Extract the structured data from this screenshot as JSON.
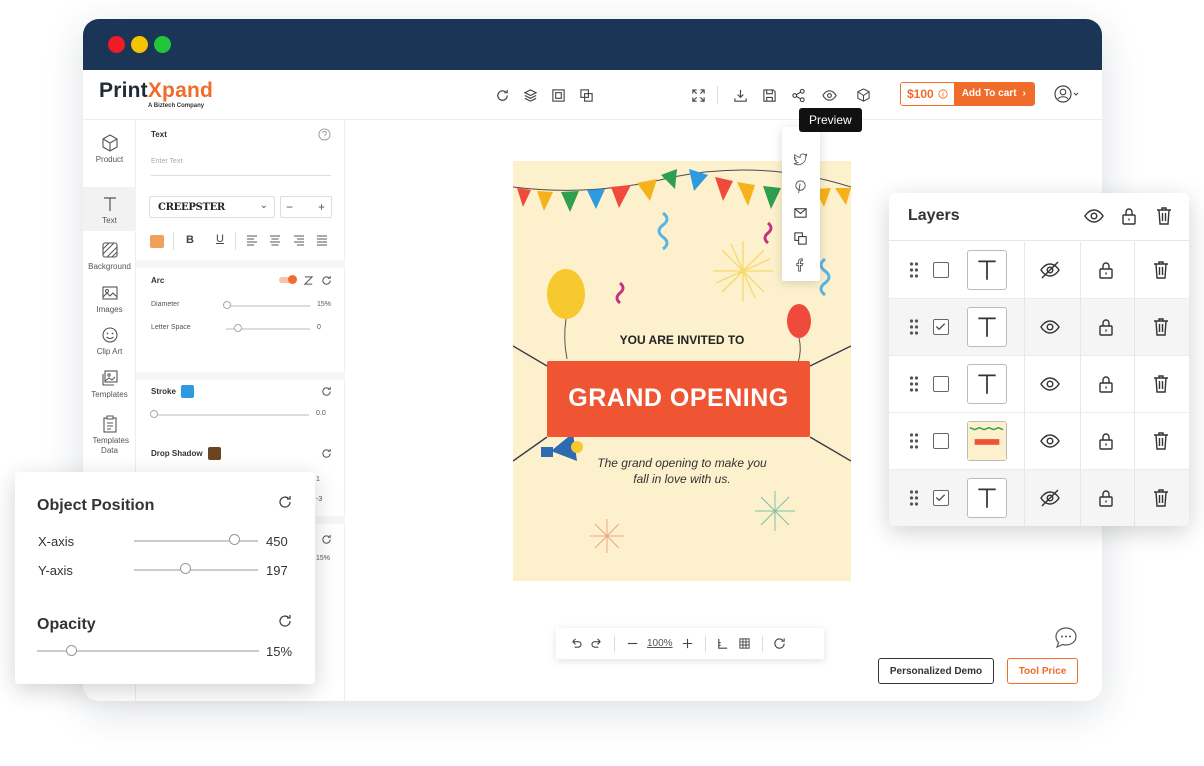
{
  "app": {
    "logo_main": "PrintXpand",
    "logo_part1": "Print",
    "logo_part2": "Xpand",
    "logo_sub": "A Biztech Company"
  },
  "header": {
    "price": "$100",
    "add_to_cart": "Add To cart",
    "tooltip": "Preview"
  },
  "rail": {
    "items": [
      {
        "label": "Product",
        "icon": "cube-icon"
      },
      {
        "label": "Text",
        "icon": "text-icon"
      },
      {
        "label": "Background",
        "icon": "background-icon"
      },
      {
        "label": "Images",
        "icon": "image-icon"
      },
      {
        "label": "Clip Art",
        "icon": "smiley-icon"
      },
      {
        "label": "Templates",
        "icon": "templates-icon"
      },
      {
        "label": "Templates Data",
        "icon": "clipboard-icon"
      }
    ]
  },
  "panel": {
    "text_heading": "Text",
    "text_placeholder": "Enter Text",
    "font_name": "CREEPSTER",
    "arc_heading": "Arc",
    "diameter_label": "Diameter",
    "diameter_value": "15%",
    "letter_space_label": "Letter Space",
    "letter_space_value": "0",
    "stroke_heading": "Stroke",
    "stroke_value": "0.0",
    "drop_shadow_heading": "Drop Shadow",
    "partial_val_1": "1",
    "partial_val_2": "-3",
    "partial_val_3": "15%"
  },
  "card": {
    "invited": "YOU ARE INVITED TO",
    "headline": "GRAND OPENING",
    "subtext_1": "The grand opening to make you",
    "subtext_2": "fall in love with us."
  },
  "zoom": {
    "level": "100%"
  },
  "buttons": {
    "demo": "Personalized Demo",
    "tool_price": "Tool Price"
  },
  "layers": {
    "title": "Layers",
    "rows": [
      {
        "checked": false,
        "type": "text",
        "visible": false
      },
      {
        "checked": true,
        "type": "text",
        "visible": true
      },
      {
        "checked": false,
        "type": "text",
        "visible": true
      },
      {
        "checked": false,
        "type": "image",
        "visible": true
      },
      {
        "checked": true,
        "type": "text",
        "visible": false
      }
    ]
  },
  "object_position": {
    "title": "Object Position",
    "x_label": "X-axis",
    "x_value": "450",
    "y_label": "Y-axis",
    "y_value": "197",
    "opacity_title": "Opacity",
    "opacity_value": "15%"
  },
  "colors": {
    "accent": "#ef6c2b",
    "titlebar": "#1a3556",
    "banner": "#ef5533",
    "card_bg": "#fcf1cc",
    "swatch_text": "#f0a05a",
    "swatch_stroke": "#2e9be0",
    "swatch_shadow": "#6b4423"
  }
}
